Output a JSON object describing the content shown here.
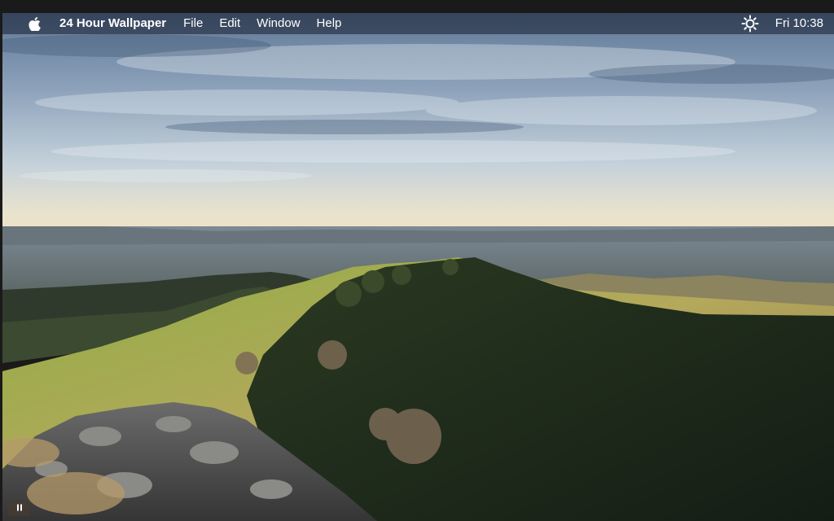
{
  "menubar": {
    "apple_icon": "apple-icon",
    "app_name": "24 Hour Wallpaper",
    "menus": [
      "File",
      "Edit",
      "Window",
      "Help"
    ],
    "status_icon": "sun-icon",
    "clock": "Fri 10:38"
  },
  "controls": {
    "pause_icon": "pause-icon"
  },
  "colors": {
    "menubar_bg": "#161e30",
    "menu_text": "#ffffff",
    "sky_top": "#5f7896",
    "horizon": "#f1e3c4",
    "hill_grass": "#7a9a3a",
    "hill_shadow": "#1c2618"
  }
}
